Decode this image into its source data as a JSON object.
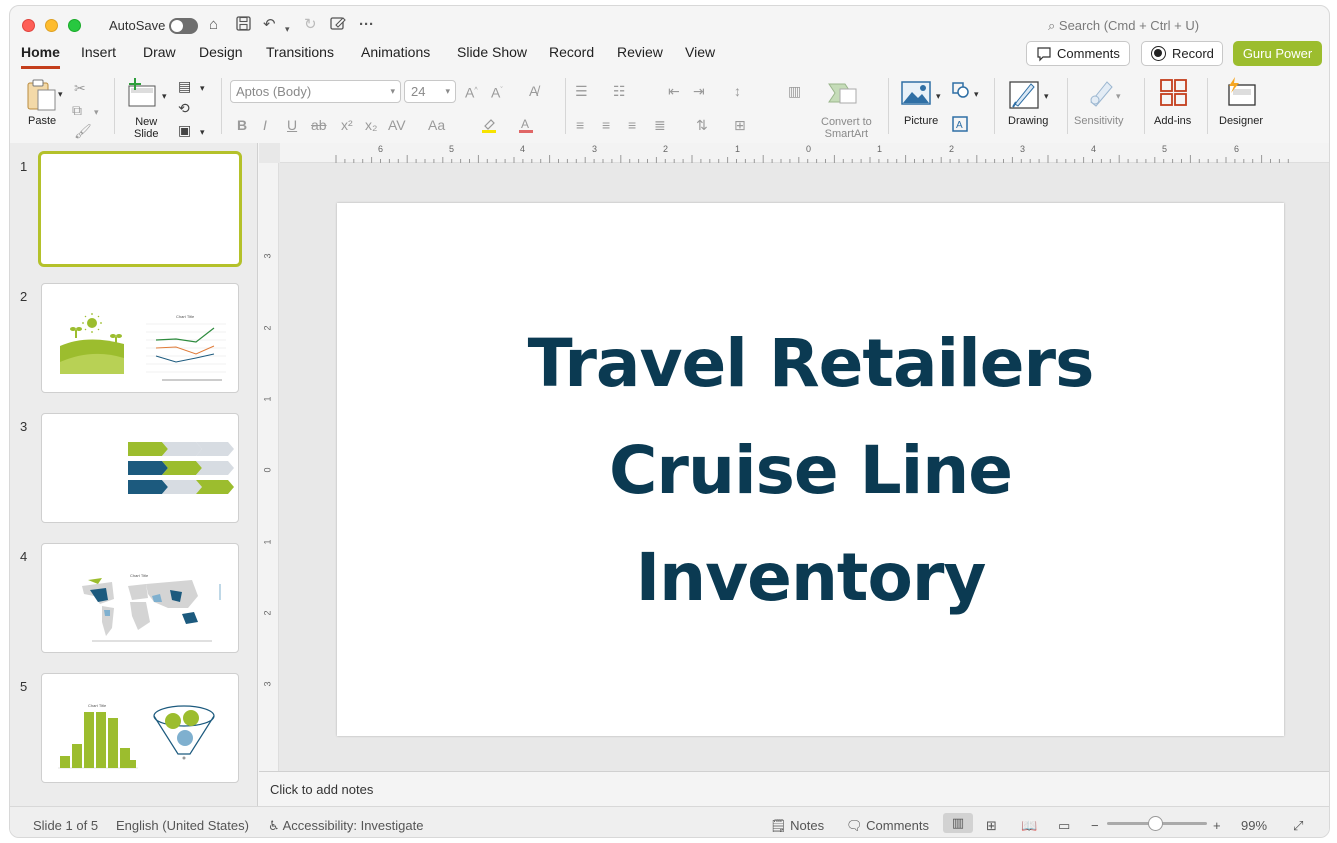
{
  "titlebar": {
    "autosave_label": "AutoSave",
    "search_placeholder": "Search (Cmd + Ctrl + U)"
  },
  "tabs": [
    "Home",
    "Insert",
    "Draw",
    "Design",
    "Transitions",
    "Animations",
    "Slide Show",
    "Record",
    "Review",
    "View"
  ],
  "header_buttons": {
    "comments": "Comments",
    "record": "Record",
    "guru": "Guru Power"
  },
  "ribbon": {
    "paste": "Paste",
    "new_slide_1": "New",
    "new_slide_2": "Slide",
    "font_name": "Aptos (Body)",
    "font_size": "24",
    "convert_1": "Convert to",
    "convert_2": "SmartArt",
    "picture": "Picture",
    "drawing": "Drawing",
    "sensitivity": "Sensitivity",
    "addins": "Add-ins",
    "designer": "Designer"
  },
  "thumbnails": [
    "1",
    "2",
    "3",
    "4",
    "5"
  ],
  "thumb_texts": {
    "chart_title": "Chart Title"
  },
  "slide": {
    "title_line1": "Travel Retailers",
    "title_line2": "Cruise Line",
    "title_line3": "Inventory"
  },
  "notes_placeholder": "Click to add notes",
  "statusbar": {
    "slide_info": "Slide 1 of 5",
    "language": "English (United States)",
    "accessibility": "Accessibility: Investigate",
    "notes": "Notes",
    "comments": "Comments",
    "zoom": "99%"
  },
  "ruler": {
    "h": [
      "6",
      "5",
      "4",
      "3",
      "2",
      "1",
      "0",
      "1",
      "2",
      "3",
      "4",
      "5",
      "6"
    ],
    "v": [
      "3",
      "2",
      "1",
      "0",
      "1",
      "2",
      "3"
    ]
  },
  "colors": {
    "accent": "#c43e1c",
    "title": "#0b3a52",
    "guru": "#9cbd2e",
    "green": "#9cbd2e",
    "navy": "#1c5a7e"
  }
}
